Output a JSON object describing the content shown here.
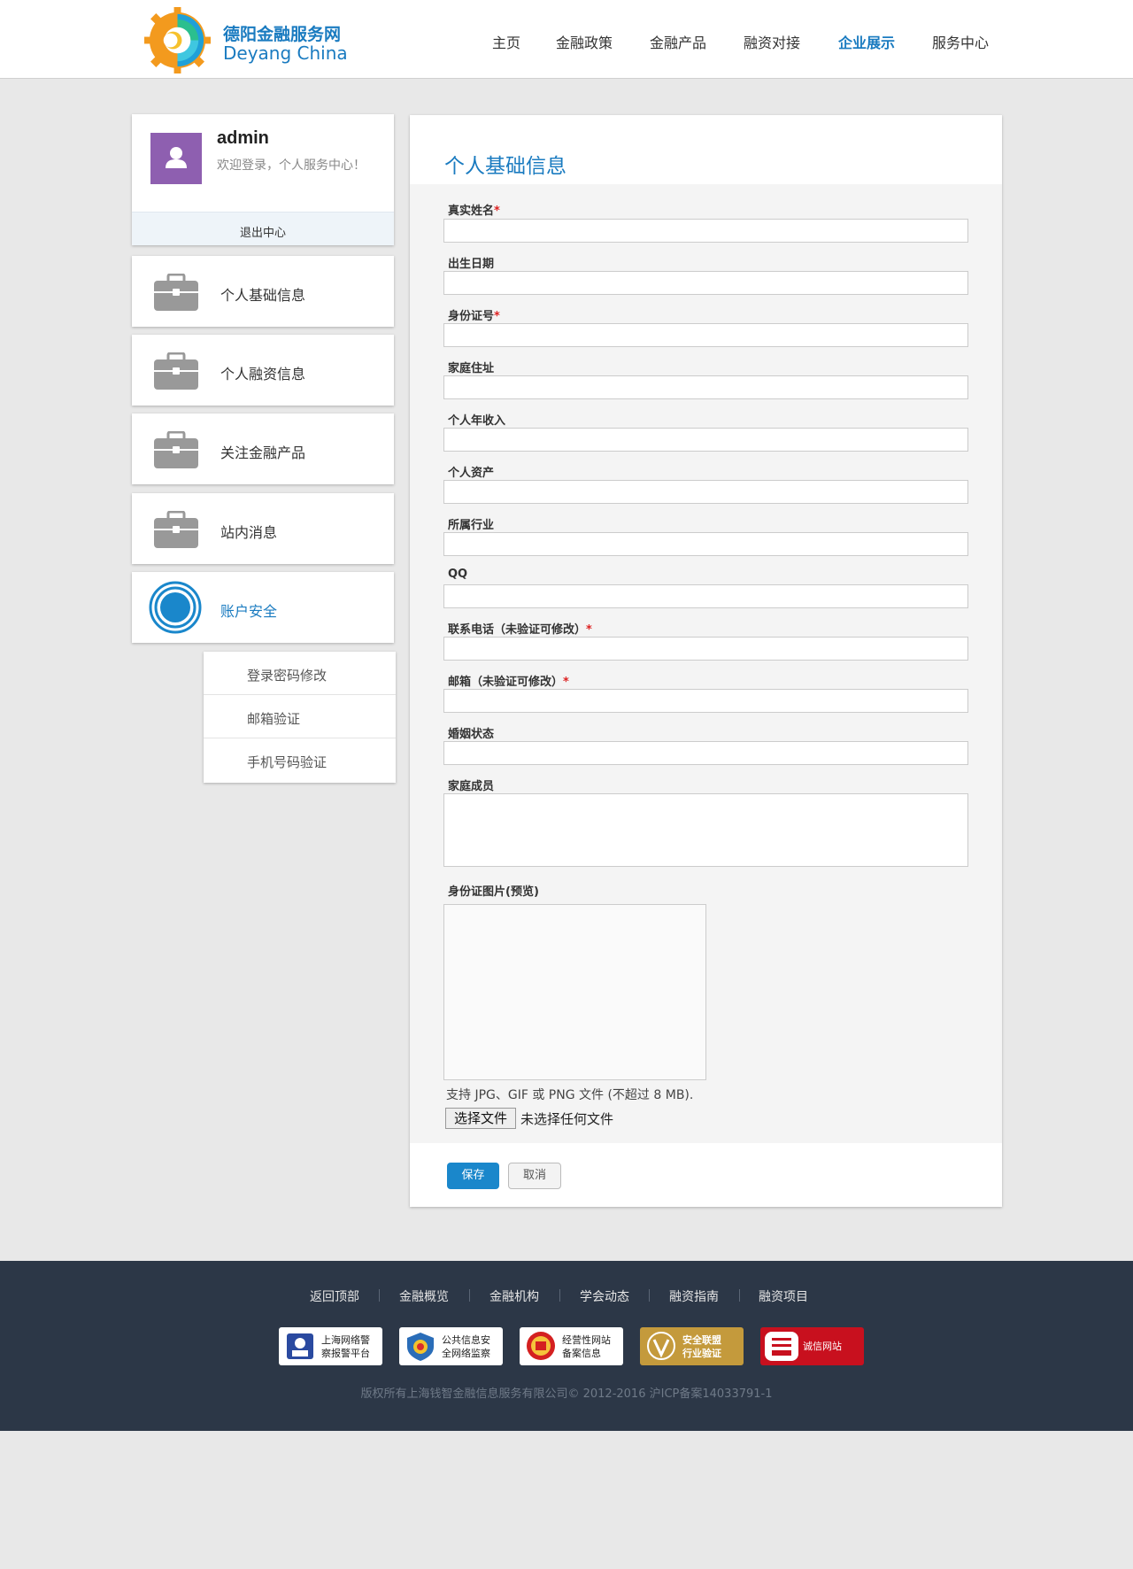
{
  "header": {
    "brand_cn": "德阳金融服务网",
    "brand_en": "Deyang China",
    "nav": [
      {
        "label": "主页",
        "active": false
      },
      {
        "label": "金融政策",
        "active": false
      },
      {
        "label": "金融产品",
        "active": false
      },
      {
        "label": "融资对接",
        "active": false
      },
      {
        "label": "企业展示",
        "active": true
      },
      {
        "label": "服务中心",
        "active": false
      }
    ]
  },
  "profile": {
    "username": "admin",
    "welcome": "欢迎登录，个人服务中心！",
    "logout": "退出中心"
  },
  "sidebar": {
    "items": [
      {
        "label": "个人基础信息",
        "icon": "briefcase-icon"
      },
      {
        "label": "个人融资信息",
        "icon": "briefcase-icon"
      },
      {
        "label": "关注金融产品",
        "icon": "briefcase-icon"
      },
      {
        "label": "站内消息",
        "icon": "briefcase-icon"
      },
      {
        "label": "账户安全",
        "icon": "target-icon",
        "active": true
      }
    ],
    "submenu": [
      {
        "label": "登录密码修改"
      },
      {
        "label": "邮箱验证"
      },
      {
        "label": "手机号码验证"
      }
    ]
  },
  "form": {
    "title": "个人基础信息",
    "fields": [
      {
        "label": "真实姓名",
        "required": true,
        "value": ""
      },
      {
        "label": "出生日期",
        "required": false,
        "value": ""
      },
      {
        "label": "身份证号",
        "required": true,
        "value": ""
      },
      {
        "label": "家庭住址",
        "required": false,
        "value": ""
      },
      {
        "label": "个人年收入",
        "required": false,
        "value": ""
      },
      {
        "label": "个人资产",
        "required": false,
        "value": ""
      },
      {
        "label": "所属行业",
        "required": false,
        "value": ""
      },
      {
        "label": "QQ",
        "required": false,
        "value": ""
      },
      {
        "label": "联系电话（未验证可修改）",
        "required": true,
        "value": ""
      },
      {
        "label": "邮箱（未验证可修改）",
        "required": true,
        "value": ""
      },
      {
        "label": "婚姻状态",
        "required": false,
        "value": ""
      }
    ],
    "family_label": "家庭成员",
    "id_image_label": "身份证图片(预览)",
    "file_hint": "支持 JPG、GIF 或 PNG 文件 (不超过 8 MB).",
    "file_button": "选择文件",
    "file_status": "未选择任何文件",
    "required_mark": "*",
    "save": "保存",
    "cancel": "取消"
  },
  "footer": {
    "links": [
      "返回顶部",
      "金融概览",
      "金融机构",
      "学会动态",
      "融资指南",
      "融资项目"
    ],
    "badges": [
      {
        "line1": "上海网络警",
        "line2": "察报警平台",
        "color": "#2a4aa0"
      },
      {
        "line1": "公共信息安",
        "line2": "全网络监察",
        "color": "#2a6db8"
      },
      {
        "line1": "经营性网站",
        "line2": "备案信息",
        "color": "#d42020"
      },
      {
        "line1": "安全联盟",
        "line2": "行业验证",
        "color": "#c49a3c"
      },
      {
        "line1": "诚信网站",
        "line2": "",
        "color": "#c8101e"
      }
    ],
    "copyright": "版权所有上海钱智金融信息服务有限公司© 2012-2016 沪ICP备案14033791-1"
  }
}
